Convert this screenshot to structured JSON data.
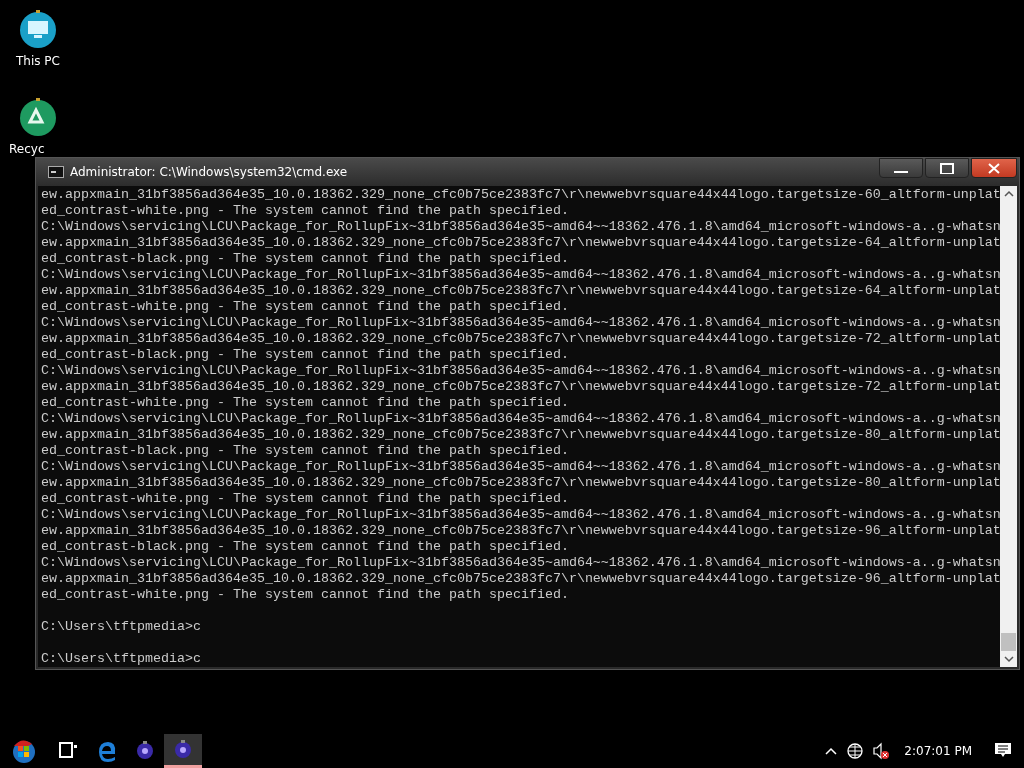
{
  "desktop_icons": [
    {
      "kind": "computer",
      "label": "This PC"
    },
    {
      "kind": "recycle",
      "label": "Recyc"
    }
  ],
  "window": {
    "title": "Administrator: C:\\Windows\\system32\\cmd.exe",
    "output": [
      "ew.appxmain_31bf3856ad364e35_10.0.18362.329_none_cfc0b75ce2383fc7\\r\\newwebvrsquare44x44logo.targetsize-60_altform-unplat",
      "ed_contrast-white.png - The system cannot find the path specified.",
      "C:\\Windows\\servicing\\LCU\\Package_for_RollupFix~31bf3856ad364e35~amd64~~18362.476.1.8\\amd64_microsoft-windows-a..g-whatsn",
      "ew.appxmain_31bf3856ad364e35_10.0.18362.329_none_cfc0b75ce2383fc7\\r\\newwebvrsquare44x44logo.targetsize-64_altform-unplat",
      "ed_contrast-black.png - The system cannot find the path specified.",
      "C:\\Windows\\servicing\\LCU\\Package_for_RollupFix~31bf3856ad364e35~amd64~~18362.476.1.8\\amd64_microsoft-windows-a..g-whatsn",
      "ew.appxmain_31bf3856ad364e35_10.0.18362.329_none_cfc0b75ce2383fc7\\r\\newwebvrsquare44x44logo.targetsize-64_altform-unplat",
      "ed_contrast-white.png - The system cannot find the path specified.",
      "C:\\Windows\\servicing\\LCU\\Package_for_RollupFix~31bf3856ad364e35~amd64~~18362.476.1.8\\amd64_microsoft-windows-a..g-whatsn",
      "ew.appxmain_31bf3856ad364e35_10.0.18362.329_none_cfc0b75ce2383fc7\\r\\newwebvrsquare44x44logo.targetsize-72_altform-unplat",
      "ed_contrast-black.png - The system cannot find the path specified.",
      "C:\\Windows\\servicing\\LCU\\Package_for_RollupFix~31bf3856ad364e35~amd64~~18362.476.1.8\\amd64_microsoft-windows-a..g-whatsn",
      "ew.appxmain_31bf3856ad364e35_10.0.18362.329_none_cfc0b75ce2383fc7\\r\\newwebvrsquare44x44logo.targetsize-72_altform-unplat",
      "ed_contrast-white.png - The system cannot find the path specified.",
      "C:\\Windows\\servicing\\LCU\\Package_for_RollupFix~31bf3856ad364e35~amd64~~18362.476.1.8\\amd64_microsoft-windows-a..g-whatsn",
      "ew.appxmain_31bf3856ad364e35_10.0.18362.329_none_cfc0b75ce2383fc7\\r\\newwebvrsquare44x44logo.targetsize-80_altform-unplat",
      "ed_contrast-black.png - The system cannot find the path specified.",
      "C:\\Windows\\servicing\\LCU\\Package_for_RollupFix~31bf3856ad364e35~amd64~~18362.476.1.8\\amd64_microsoft-windows-a..g-whatsn",
      "ew.appxmain_31bf3856ad364e35_10.0.18362.329_none_cfc0b75ce2383fc7\\r\\newwebvrsquare44x44logo.targetsize-80_altform-unplat",
      "ed_contrast-white.png - The system cannot find the path specified.",
      "C:\\Windows\\servicing\\LCU\\Package_for_RollupFix~31bf3856ad364e35~amd64~~18362.476.1.8\\amd64_microsoft-windows-a..g-whatsn",
      "ew.appxmain_31bf3856ad364e35_10.0.18362.329_none_cfc0b75ce2383fc7\\r\\newwebvrsquare44x44logo.targetsize-96_altform-unplat",
      "ed_contrast-black.png - The system cannot find the path specified.",
      "C:\\Windows\\servicing\\LCU\\Package_for_RollupFix~31bf3856ad364e35~amd64~~18362.476.1.8\\amd64_microsoft-windows-a..g-whatsn",
      "ew.appxmain_31bf3856ad364e35_10.0.18362.329_none_cfc0b75ce2383fc7\\r\\newwebvrsquare44x44logo.targetsize-96_altform-unplat",
      "ed_contrast-white.png - The system cannot find the path specified."
    ],
    "prompts": [
      "C:\\Users\\tftpmedia>c",
      "C:\\Users\\tftpmedia>c"
    ]
  },
  "taskbar": {
    "apps": [
      {
        "kind": "start",
        "selected": false
      },
      {
        "kind": "task_view",
        "selected": false
      },
      {
        "kind": "edge",
        "selected": false
      },
      {
        "kind": "ornament",
        "selected": false
      },
      {
        "kind": "ornament",
        "selected": true
      }
    ],
    "clock": "2:07:01 PM"
  }
}
